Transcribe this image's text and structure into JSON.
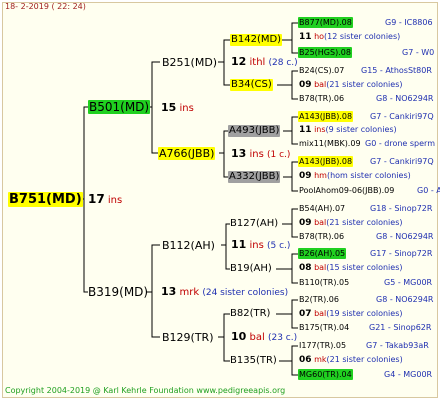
{
  "date": "18-  2-2019 (  22:  24)",
  "copyright": "Copyright 2004-2019 @ Karl Kehrle Foundation   www.pedigreeapis.org",
  "root": {
    "name": "B751(MD)",
    "ins": "17",
    "ins_word": "ins"
  },
  "gen1": [
    {
      "name": "B501(MD)",
      "ins": "15",
      "ins_word": "ins"
    },
    {
      "name": "B319(MD)",
      "ins": "13",
      "ins_word": "mrk",
      "sisters": "(24 sister colonies)"
    }
  ],
  "gen2": [
    {
      "name": "B251(MD)",
      "ins": "12",
      "ins_word": "ithl",
      "sisters": "(28 c.)"
    },
    {
      "name": "A766(JBB)",
      "ins": "13",
      "ins_word": "ins",
      "sisters": "(1 c.)"
    },
    {
      "name": "B112(AH)",
      "ins": "11",
      "ins_word": "ins",
      "sisters": "(5 c.)"
    },
    {
      "name": "B129(TR)",
      "ins": "10",
      "ins_word": "bal",
      "sisters": "(23 c.)"
    }
  ],
  "gen3": [
    {
      "name": "B142(MD)"
    },
    {
      "name": "B34(CS)"
    },
    {
      "name": "A493(JBB)"
    },
    {
      "name": "A332(JBB)"
    },
    {
      "name": "B127(AH)"
    },
    {
      "name": "B19(AH)"
    },
    {
      "name": "B82(TR)"
    },
    {
      "name": "B135(TR)"
    }
  ],
  "gen4": [
    {
      "top": "B877(MD).08",
      "top_right": "G9 - IC8806",
      "ins": "11",
      "ins_word": "ho",
      "sisters": "(12 sister colonies)",
      "bottom": "B25(HGS).08",
      "bottom_right": "G7 - W0"
    },
    {
      "top": "B24(CS).07",
      "top_right": "G15 - AthosSt80R",
      "ins": "09",
      "ins_word": "bal",
      "sisters": "(21 sister colonies)",
      "bottom": "B78(TR).06",
      "bottom_right": "G8 - NO6294R"
    },
    {
      "top": "A143(JBB).08",
      "top_right": "G7 - Cankiri97Q",
      "ins": "11",
      "ins_word": "ins",
      "sisters": "(9 sister colonies)",
      "bottom": "mix11(MBK).09",
      "bottom_right": "G0 - drone sperm"
    },
    {
      "top": "A143(JBB).08",
      "top_right": "G7 - Cankiri97Q",
      "ins": "09",
      "ins_word": "hm",
      "sisters": "(hom sister colonies)",
      "bottom": "PoolAhom09-06(JBB).09",
      "bottom_right": "G0 - A"
    },
    {
      "top": "B54(AH).07",
      "top_right": "G18 - Sinop72R",
      "ins": "09",
      "ins_word": "bal",
      "sisters": "(21 sister colonies)",
      "bottom": "B78(TR).06",
      "bottom_right": "G8 - NO6294R"
    },
    {
      "top": "B26(AH).05",
      "top_right": "G17 - Sinop72R",
      "ins": "08",
      "ins_word": "bal",
      "sisters": "(15 sister colonies)",
      "bottom": "B110(TR).05",
      "bottom_right": "G5 - MG00R"
    },
    {
      "top": "B2(TR).06",
      "top_right": "G8 - NO6294R",
      "ins": "07",
      "ins_word": "bal",
      "sisters": "(19 sister colonies)",
      "bottom": "B175(TR).04",
      "bottom_right": "G21 - Sinop62R"
    },
    {
      "top": "I177(TR).05",
      "top_right": "G7 - Takab93aR",
      "ins": "06",
      "ins_word": "mk",
      "sisters": "(21 sister colonies)",
      "bottom": "MG60(TR).04",
      "bottom_right": "G4 - MG00R"
    }
  ],
  "colors": {
    "yellow": "#ffff00",
    "green": "#20d020",
    "gray": "#a0a0a0",
    "link_blue": "#2030b0",
    "ins_red": "#c00000"
  }
}
